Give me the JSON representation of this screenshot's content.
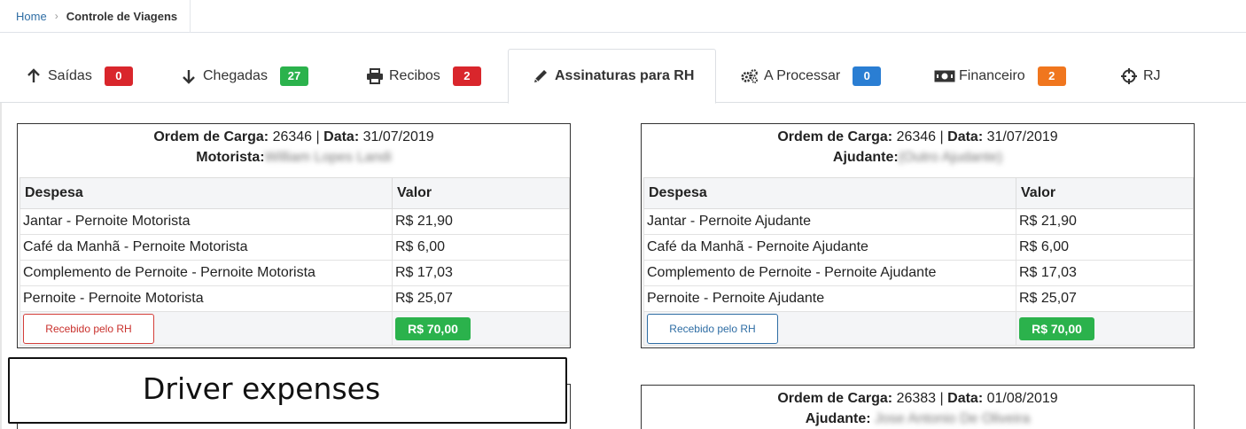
{
  "breadcrumb": {
    "home": "Home",
    "separator": "›",
    "current": "Controle de Viagens"
  },
  "tabs": [
    {
      "label": "Saídas",
      "icon": "arrow-up-icon",
      "badge": "0",
      "badge_color": "#d9262c"
    },
    {
      "label": "Chegadas",
      "icon": "arrow-down-icon",
      "badge": "27",
      "badge_color": "#2bb24c"
    },
    {
      "label": "Recibos",
      "icon": "print-icon",
      "badge": "2",
      "badge_color": "#d9262c"
    },
    {
      "label": "Assinaturas para RH",
      "icon": "pencil-icon",
      "active": true
    },
    {
      "label": "A Processar",
      "icon": "gears-icon",
      "badge": "0",
      "badge_color": "#2a7ed3"
    },
    {
      "label": "Financeiro",
      "icon": "money-icon",
      "badge": "2",
      "badge_color": "#f0761e"
    },
    {
      "label": "RJ",
      "icon": "crosshairs-icon"
    }
  ],
  "cards": [
    {
      "order_label": "Ordem de Carga:",
      "order": "26346",
      "sep": "|",
      "date_label": "Data:",
      "date": "31/07/2019",
      "person_label": "Motorista:",
      "person": "William Lopes Landi",
      "col_expense": "Despesa",
      "col_value": "Valor",
      "rows": [
        {
          "expense": "Jantar - Pernoite Motorista",
          "value": "R$ 21,90"
        },
        {
          "expense": "Café da Manhã - Pernoite Motorista",
          "value": "R$ 6,00"
        },
        {
          "expense": "Complemento de Pernoite - Pernoite Motorista",
          "value": "R$ 17,03"
        },
        {
          "expense": "Pernoite - Pernoite Motorista",
          "value": "R$ 25,07"
        }
      ],
      "button": "Recebido pelo RH",
      "total": "R$ 70,00"
    },
    {
      "order_label": "Ordem de Carga:",
      "order": "26346",
      "sep": "|",
      "date_label": "Data:",
      "date": "31/07/2019",
      "person_label": "Ajudante:",
      "person": "(Outro Ajudante)",
      "col_expense": "Despesa",
      "col_value": "Valor",
      "rows": [
        {
          "expense": "Jantar - Pernoite Ajudante",
          "value": "R$ 21,90"
        },
        {
          "expense": "Café da Manhã - Pernoite Ajudante",
          "value": "R$ 6,00"
        },
        {
          "expense": "Complemento de Pernoite - Pernoite Ajudante",
          "value": "R$ 17,03"
        },
        {
          "expense": "Pernoite - Pernoite Ajudante",
          "value": "R$ 25,07"
        }
      ],
      "button": "Recebido pelo RH",
      "total": "R$ 70,00"
    },
    {
      "order_label": "Ordem de Carga:",
      "order": "26383",
      "sep": "|",
      "date_label": "Data:",
      "date": "01/08/2019",
      "person_label": "Ajudante:",
      "person": "Jose Antonio De Oliveira"
    }
  ],
  "annotation": "Driver expenses",
  "colors": {
    "link": "#2e6da4",
    "total_green": "#2bb24c",
    "red": "#d43f3a",
    "blue": "#2e6da4"
  }
}
